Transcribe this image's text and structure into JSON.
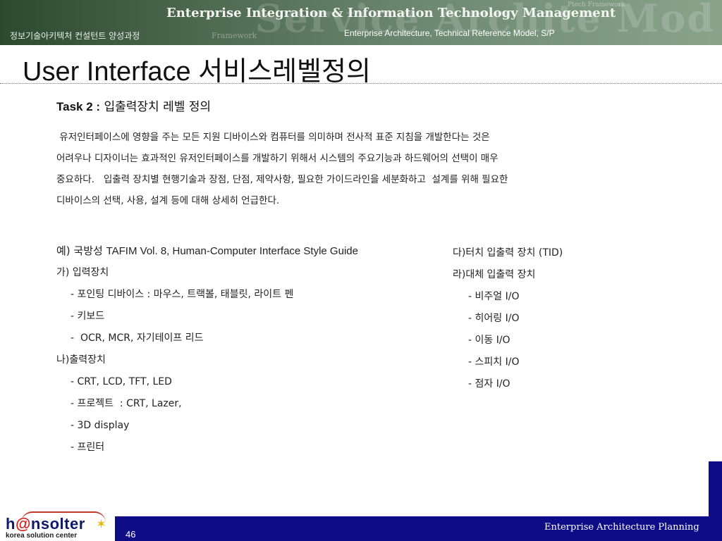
{
  "header": {
    "banner_title": "Enterprise Integration & Information Technology Management",
    "left_caption": "정보기술아키텍처 컨설턴트 양성과정",
    "right_caption": "Enterprise Architecture, Technical Reference Model, S/P"
  },
  "slide": {
    "title": "User Interface 서비스레벨정의",
    "task_label": "Task 2 :",
    "task_text": " 입출력장치 레벨 정의",
    "intro_lines": [
      " 유저인터페이스에 영향을 주는 모든 지원 디바이스와 컴퓨터를 의미하며 전사적 표준 지침을 개발한다는 것은",
      "어려우나 디자이너는 효과적인 유저인터페이스를 개발하기 위해서 시스템의 주요기능과 하드웨어의 선택이 매우",
      "중요하다.   입출력 장치별 현행기술과 장점, 단점, 제약사항, 필요한 가이드라인을 세분화하고  설계를 위해 필요한",
      "디바이스의 선택, 사용, 설계 등에 대해 상세히 언급한다."
    ],
    "example_lead": "예) 국방성 ",
    "example_ref": "TAFIM Vol. 8, Human-Computer Interface Style Guide",
    "left_list": {
      "input_heading": "가) 입력장치",
      "input_items": [
        "- 포인팅 디바이스 : 마우스, 트랙볼, 태블릿, 라이트 펜",
        "- 키보드",
        "-  OCR, MCR, 자기테이프 리드"
      ],
      "output_heading": "나)출력장치",
      "output_items": [
        "- CRT, LCD, TFT, LED",
        "- 프로젝트  : CRT, Lazer,",
        "- 3D display",
        "- 프린터"
      ]
    },
    "right_list": {
      "touch_heading": "다)터치 입출력 장치 (TID)",
      "alt_heading": "라)대체 입출력 장치",
      "alt_items": [
        "- 비주얼 I/O",
        "- 히어링 I/O",
        "- 이동 I/O",
        "- 스피치 I/O",
        "- 점자 I/O"
      ]
    }
  },
  "footer": {
    "logo_main_a": "h",
    "logo_main_at": "@",
    "logo_main_b": "nsolter",
    "logo_sub": "korea solution center",
    "page_number": "46",
    "right_caption": "Enterprise Architecture Planning"
  },
  "colors": {
    "footer_bar": "#0e0c86",
    "banner_green": "#4f6b52",
    "logo_blue": "#0d1a6e",
    "logo_red": "#d61c1c"
  }
}
